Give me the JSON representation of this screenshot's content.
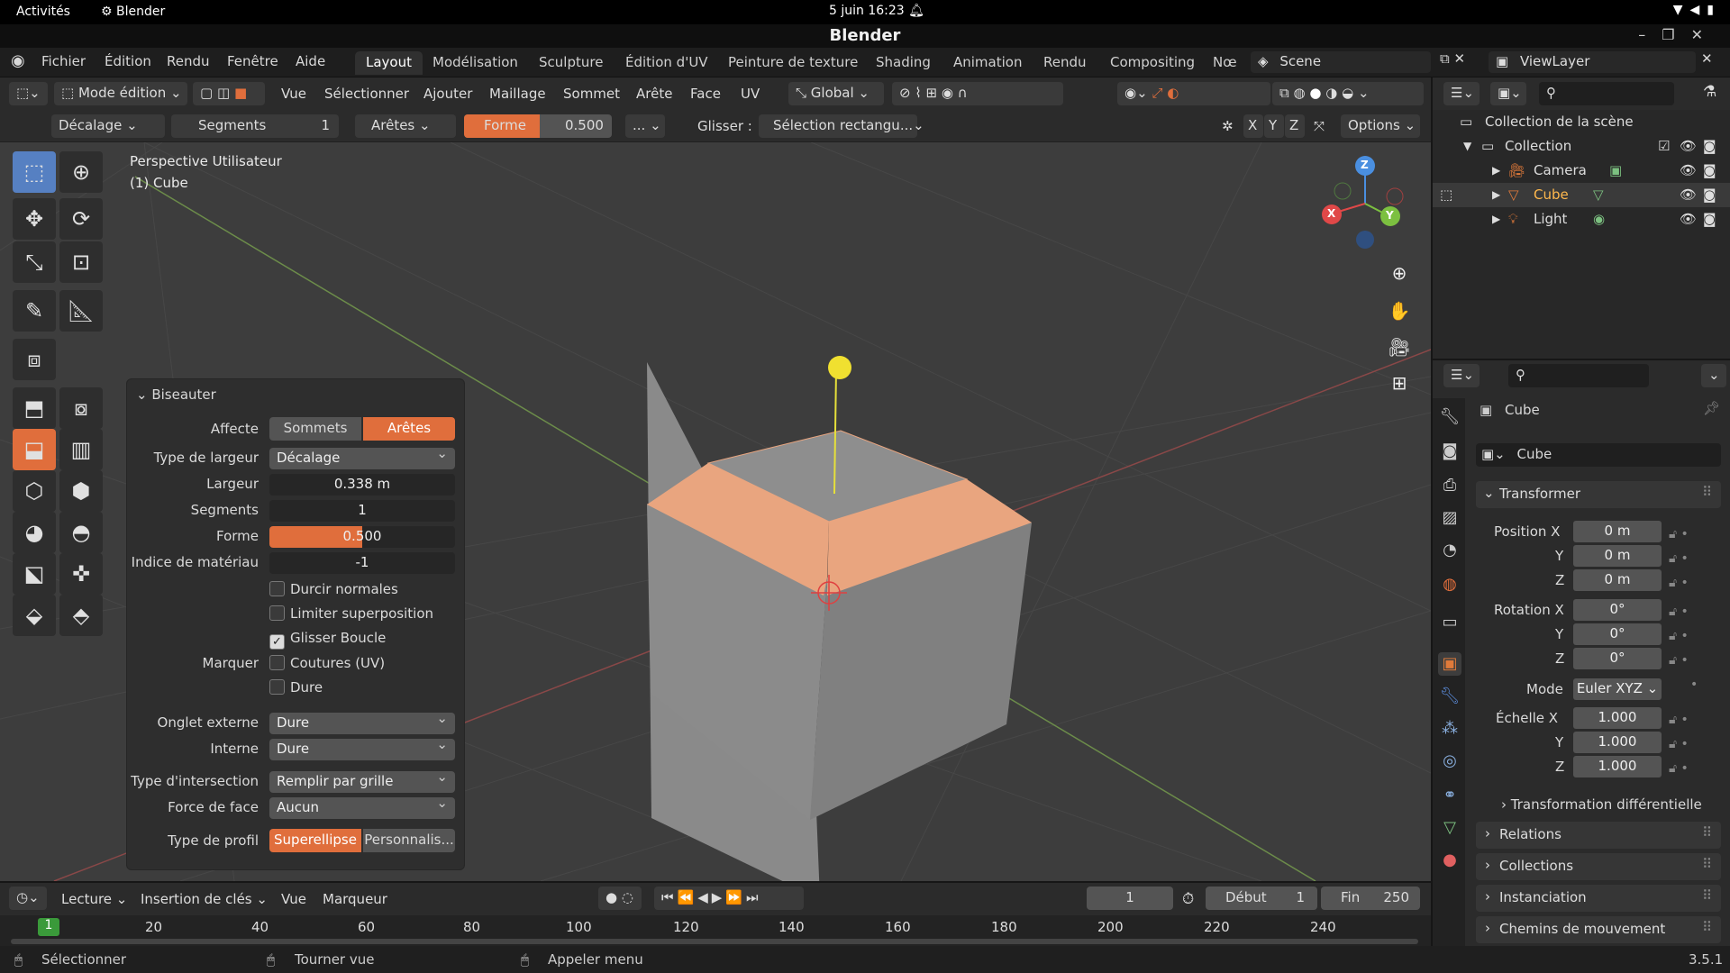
{
  "gnome": {
    "activities": "Activités",
    "app": "Blender",
    "clock": "5 juin 16:23"
  },
  "window": {
    "title": "Blender"
  },
  "menu": [
    "Fichier",
    "Édition",
    "Rendu",
    "Fenêtre",
    "Aide"
  ],
  "workspaces": [
    "Layout",
    "Modélisation",
    "Sculpture",
    "Édition d'UV",
    "Peinture de texture",
    "Shading",
    "Animation",
    "Rendu",
    "Compositing",
    "Nœ"
  ],
  "scene": {
    "name": "Scene",
    "view_layer": "ViewLayer"
  },
  "header": {
    "mode": "Mode édition",
    "menus": [
      "Vue",
      "Sélectionner",
      "Ajouter",
      "Maillage",
      "Sommet",
      "Arête",
      "Face",
      "UV"
    ],
    "orientation": "Global"
  },
  "tool_settings": {
    "width_type": "Décalage",
    "segments_label": "Segments",
    "segments_value": "1",
    "affect": "Arêtes",
    "shape_label": "Forme",
    "shape_value": "0.500",
    "more": "...",
    "slide_label": "Glisser :",
    "select_mode": "Sélection rectangu...",
    "axes": [
      "X",
      "Y",
      "Z"
    ],
    "options": "Options"
  },
  "viewport": {
    "perspective": "Perspective Utilisateur",
    "object": "(1) Cube"
  },
  "bevel_panel": {
    "title": "Biseauter",
    "affect_label": "Affecte",
    "affect_options": [
      "Sommets",
      "Arêtes"
    ],
    "width_type_label": "Type de largeur",
    "width_type": "Décalage",
    "width_label": "Largeur",
    "width": "0.338 m",
    "segments_label": "Segments",
    "segments": "1",
    "shape_label": "Forme",
    "shape": "0.500",
    "shape_fraction": 0.5,
    "material_label": "Indice de matériau",
    "material": "-1",
    "harden_normals": "Durcir normales",
    "clamp_overlap": "Limiter superposition",
    "loop_slide": "Glisser Boucle",
    "mark_label": "Marquer",
    "mark_seams": "Coutures (UV)",
    "mark_sharp": "Dure",
    "outer_miter_label": "Onglet externe",
    "outer_miter": "Dure",
    "inner_miter_label": "Interne",
    "inner_miter": "Dure",
    "intersection_label": "Type d'intersection",
    "intersection": "Remplir par grille",
    "face_strength_label": "Force de face",
    "face_strength": "Aucun",
    "profile_label": "Type de profil",
    "profile_options": [
      "Superellipse",
      "Personnalis..."
    ]
  },
  "gizmo": {
    "x": "X",
    "y": "Y",
    "z": "Z"
  },
  "outliner": {
    "scene_collection": "Collection de la scène",
    "collection": "Collection",
    "items": [
      "Camera",
      "Cube",
      "Light"
    ]
  },
  "properties": {
    "object_name": "Cube",
    "data_name": "Cube",
    "transform": "Transformer",
    "location_label": "Position X",
    "location": [
      "0 m",
      "0 m",
      "0 m"
    ],
    "rotation_label": "Rotation X",
    "rotation": [
      "0°",
      "0°",
      "0°"
    ],
    "mode_label": "Mode",
    "mode": "Euler XYZ",
    "scale_label": "Échelle X",
    "scale": [
      "1.000",
      "1.000",
      "1.000"
    ],
    "axis_y": "Y",
    "axis_z": "Z",
    "delta": "Transformation différentielle",
    "sections": [
      "Relations",
      "Collections",
      "Instanciation",
      "Chemins de mouvement"
    ]
  },
  "timeline": {
    "playback": "Lecture",
    "keying": "Insertion de clés",
    "view": "Vue",
    "marker": "Marqueur",
    "current_frame": "1",
    "start_label": "Début",
    "start": "1",
    "end_label": "Fin",
    "end": "250",
    "ticks": [
      "20",
      "40",
      "60",
      "80",
      "100",
      "120",
      "140",
      "160",
      "180",
      "200",
      "220",
      "240"
    ],
    "frame_marker": "1"
  },
  "status": {
    "select": "Sélectionner",
    "rotate": "Tourner vue",
    "menu": "Appeler menu",
    "version": "3.5.1"
  },
  "colors": {
    "accent_orange": "#e06e3c",
    "selected_blue": "#5680c2",
    "viewport_bg": "#3d3d3d",
    "bevel_face": "#e9a57f"
  }
}
